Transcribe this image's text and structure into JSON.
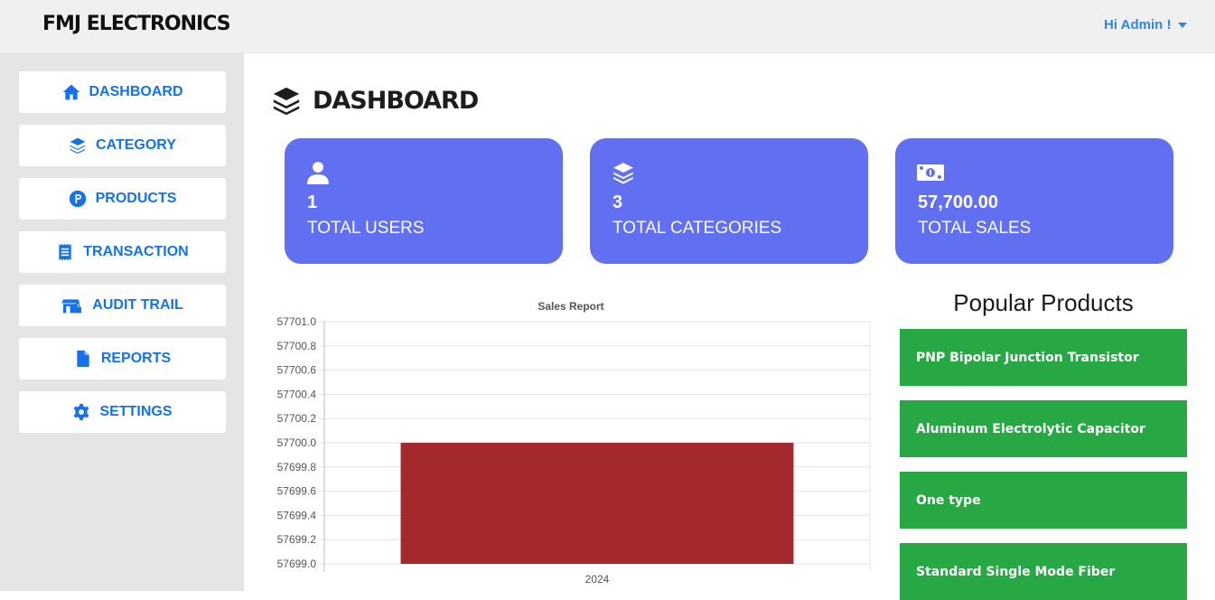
{
  "header": {
    "brand": "FMJ ELECTRONICS",
    "user_greeting": "Hi Admin !"
  },
  "sidebar": {
    "items": [
      {
        "label": "DASHBOARD",
        "icon": "home-icon"
      },
      {
        "label": "CATEGORY",
        "icon": "layers-icon"
      },
      {
        "label": "PRODUCTS",
        "icon": "product-p-icon"
      },
      {
        "label": "TRANSACTION",
        "icon": "receipt-icon"
      },
      {
        "label": "AUDIT TRAIL",
        "icon": "store-lock-icon"
      },
      {
        "label": "REPORTS",
        "icon": "file-icon"
      },
      {
        "label": "SETTINGS",
        "icon": "gear-icon"
      }
    ]
  },
  "main": {
    "title": "DASHBOARD",
    "title_icon": "layers-icon",
    "cards": [
      {
        "value": "1",
        "label": "TOTAL USERS",
        "icon": "user-icon"
      },
      {
        "value": "3",
        "label": "TOTAL CATEGORIES",
        "icon": "layers-icon"
      },
      {
        "value": "57,700.00",
        "label": "TOTAL SALES",
        "icon": "money-icon"
      }
    ],
    "popular": {
      "title": "Popular Products",
      "items": [
        "PNP Bipolar Junction Transistor",
        "Aluminum Electrolytic Capacitor",
        "One type",
        "Standard Single Mode Fiber"
      ]
    }
  },
  "colors": {
    "accent": "#1572e8",
    "card_bg": "#6170f0",
    "bar": "#a4292c",
    "popular_bg": "#28a745"
  },
  "chart_data": {
    "type": "bar",
    "title": "Sales Report",
    "categories": [
      "2024"
    ],
    "values": [
      57700.0
    ],
    "ylim": [
      57699.0,
      57701.0
    ],
    "yticks": [
      "57701.0",
      "57700.8",
      "57700.6",
      "57700.4",
      "57700.2",
      "57700.0",
      "57699.8",
      "57699.6",
      "57699.4",
      "57699.2",
      "57699.0"
    ],
    "grid": true,
    "legend": "none"
  }
}
